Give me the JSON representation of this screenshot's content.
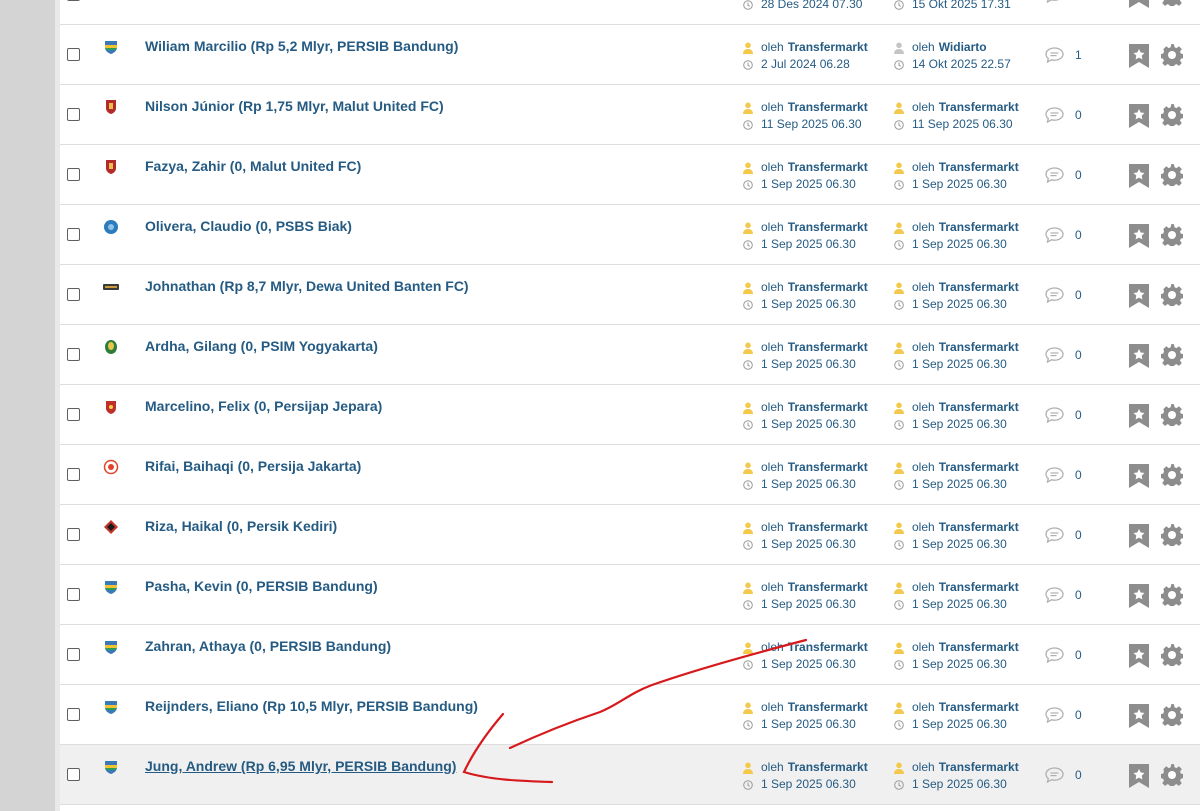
{
  "labels": {
    "by": "oleh"
  },
  "colors": {
    "link": "#255b83",
    "user_icon_active": "#f2c94c",
    "user_icon_inactive": "#c5c5c5",
    "icon_gray": "#9a9a9a",
    "annotation": "#d7191c"
  },
  "topics": [
    {
      "title": "",
      "logo": "persib",
      "starter": "",
      "starter_date": "28 Des 2024 07.30",
      "last_poster": "",
      "last_date": "15 Okt 2025 17.31",
      "replies": "",
      "last_icon": "active"
    },
    {
      "title": "Wiliam Marcilio (Rp 5,2 Mlyr, PERSIB Bandung)",
      "logo": "persib",
      "starter": "Transfermarkt",
      "starter_date": "2 Jul 2024 06.28",
      "last_poster": "Widiarto",
      "last_date": "14 Okt 2025 22.57",
      "replies": "1",
      "last_icon": "inactive"
    },
    {
      "title": "Nilson Júnior (Rp 1,75 Mlyr, Malut United FC)",
      "logo": "malut",
      "starter": "Transfermarkt",
      "starter_date": "11 Sep 2025 06.30",
      "last_poster": "Transfermarkt",
      "last_date": "11 Sep 2025 06.30",
      "replies": "0",
      "last_icon": "active"
    },
    {
      "title": "Fazya, Zahir (0, Malut United FC)",
      "logo": "malut",
      "starter": "Transfermarkt",
      "starter_date": "1 Sep 2025 06.30",
      "last_poster": "Transfermarkt",
      "last_date": "1 Sep 2025 06.30",
      "replies": "0",
      "last_icon": "active"
    },
    {
      "title": "Olivera, Claudio (0, PSBS Biak)",
      "logo": "psbs",
      "starter": "Transfermarkt",
      "starter_date": "1 Sep 2025 06.30",
      "last_poster": "Transfermarkt",
      "last_date": "1 Sep 2025 06.30",
      "replies": "0",
      "last_icon": "active"
    },
    {
      "title": "Johnathan (Rp 8,7 Mlyr, Dewa United Banten FC)",
      "logo": "dewa",
      "starter": "Transfermarkt",
      "starter_date": "1 Sep 2025 06.30",
      "last_poster": "Transfermarkt",
      "last_date": "1 Sep 2025 06.30",
      "replies": "0",
      "last_icon": "active"
    },
    {
      "title": "Ardha, Gilang (0, PSIM Yogyakarta)",
      "logo": "psim",
      "starter": "Transfermarkt",
      "starter_date": "1 Sep 2025 06.30",
      "last_poster": "Transfermarkt",
      "last_date": "1 Sep 2025 06.30",
      "replies": "0",
      "last_icon": "active"
    },
    {
      "title": "Marcelino, Felix (0, Persijap Jepara)",
      "logo": "persijap",
      "starter": "Transfermarkt",
      "starter_date": "1 Sep 2025 06.30",
      "last_poster": "Transfermarkt",
      "last_date": "1 Sep 2025 06.30",
      "replies": "0",
      "last_icon": "active"
    },
    {
      "title": "Rifai, Baihaqi (0, Persija Jakarta)",
      "logo": "persija",
      "starter": "Transfermarkt",
      "starter_date": "1 Sep 2025 06.30",
      "last_poster": "Transfermarkt",
      "last_date": "1 Sep 2025 06.30",
      "replies": "0",
      "last_icon": "active"
    },
    {
      "title": "Riza, Haikal (0, Persik Kediri)",
      "logo": "persik",
      "starter": "Transfermarkt",
      "starter_date": "1 Sep 2025 06.30",
      "last_poster": "Transfermarkt",
      "last_date": "1 Sep 2025 06.30",
      "replies": "0",
      "last_icon": "active"
    },
    {
      "title": "Pasha, Kevin (0, PERSIB Bandung)",
      "logo": "persib",
      "starter": "Transfermarkt",
      "starter_date": "1 Sep 2025 06.30",
      "last_poster": "Transfermarkt",
      "last_date": "1 Sep 2025 06.30",
      "replies": "0",
      "last_icon": "active"
    },
    {
      "title": "Zahran, Athaya (0, PERSIB Bandung)",
      "logo": "persib",
      "starter": "Transfermarkt",
      "starter_date": "1 Sep 2025 06.30",
      "last_poster": "Transfermarkt",
      "last_date": "1 Sep 2025 06.30",
      "replies": "0",
      "last_icon": "active"
    },
    {
      "title": "Reijnders, Eliano (Rp 10,5 Mlyr, PERSIB Bandung)",
      "logo": "persib",
      "starter": "Transfermarkt",
      "starter_date": "1 Sep 2025 06.30",
      "last_poster": "Transfermarkt",
      "last_date": "1 Sep 2025 06.30",
      "replies": "0",
      "last_icon": "active"
    },
    {
      "title": "Jung, Andrew (Rp 6,95 Mlyr, PERSIB Bandung)",
      "logo": "persib",
      "starter": "Transfermarkt",
      "starter_date": "1 Sep 2025 06.30",
      "last_poster": "Transfermarkt",
      "last_date": "1 Sep 2025 06.30",
      "replies": "0",
      "last_icon": "active",
      "highlighted": true
    }
  ]
}
